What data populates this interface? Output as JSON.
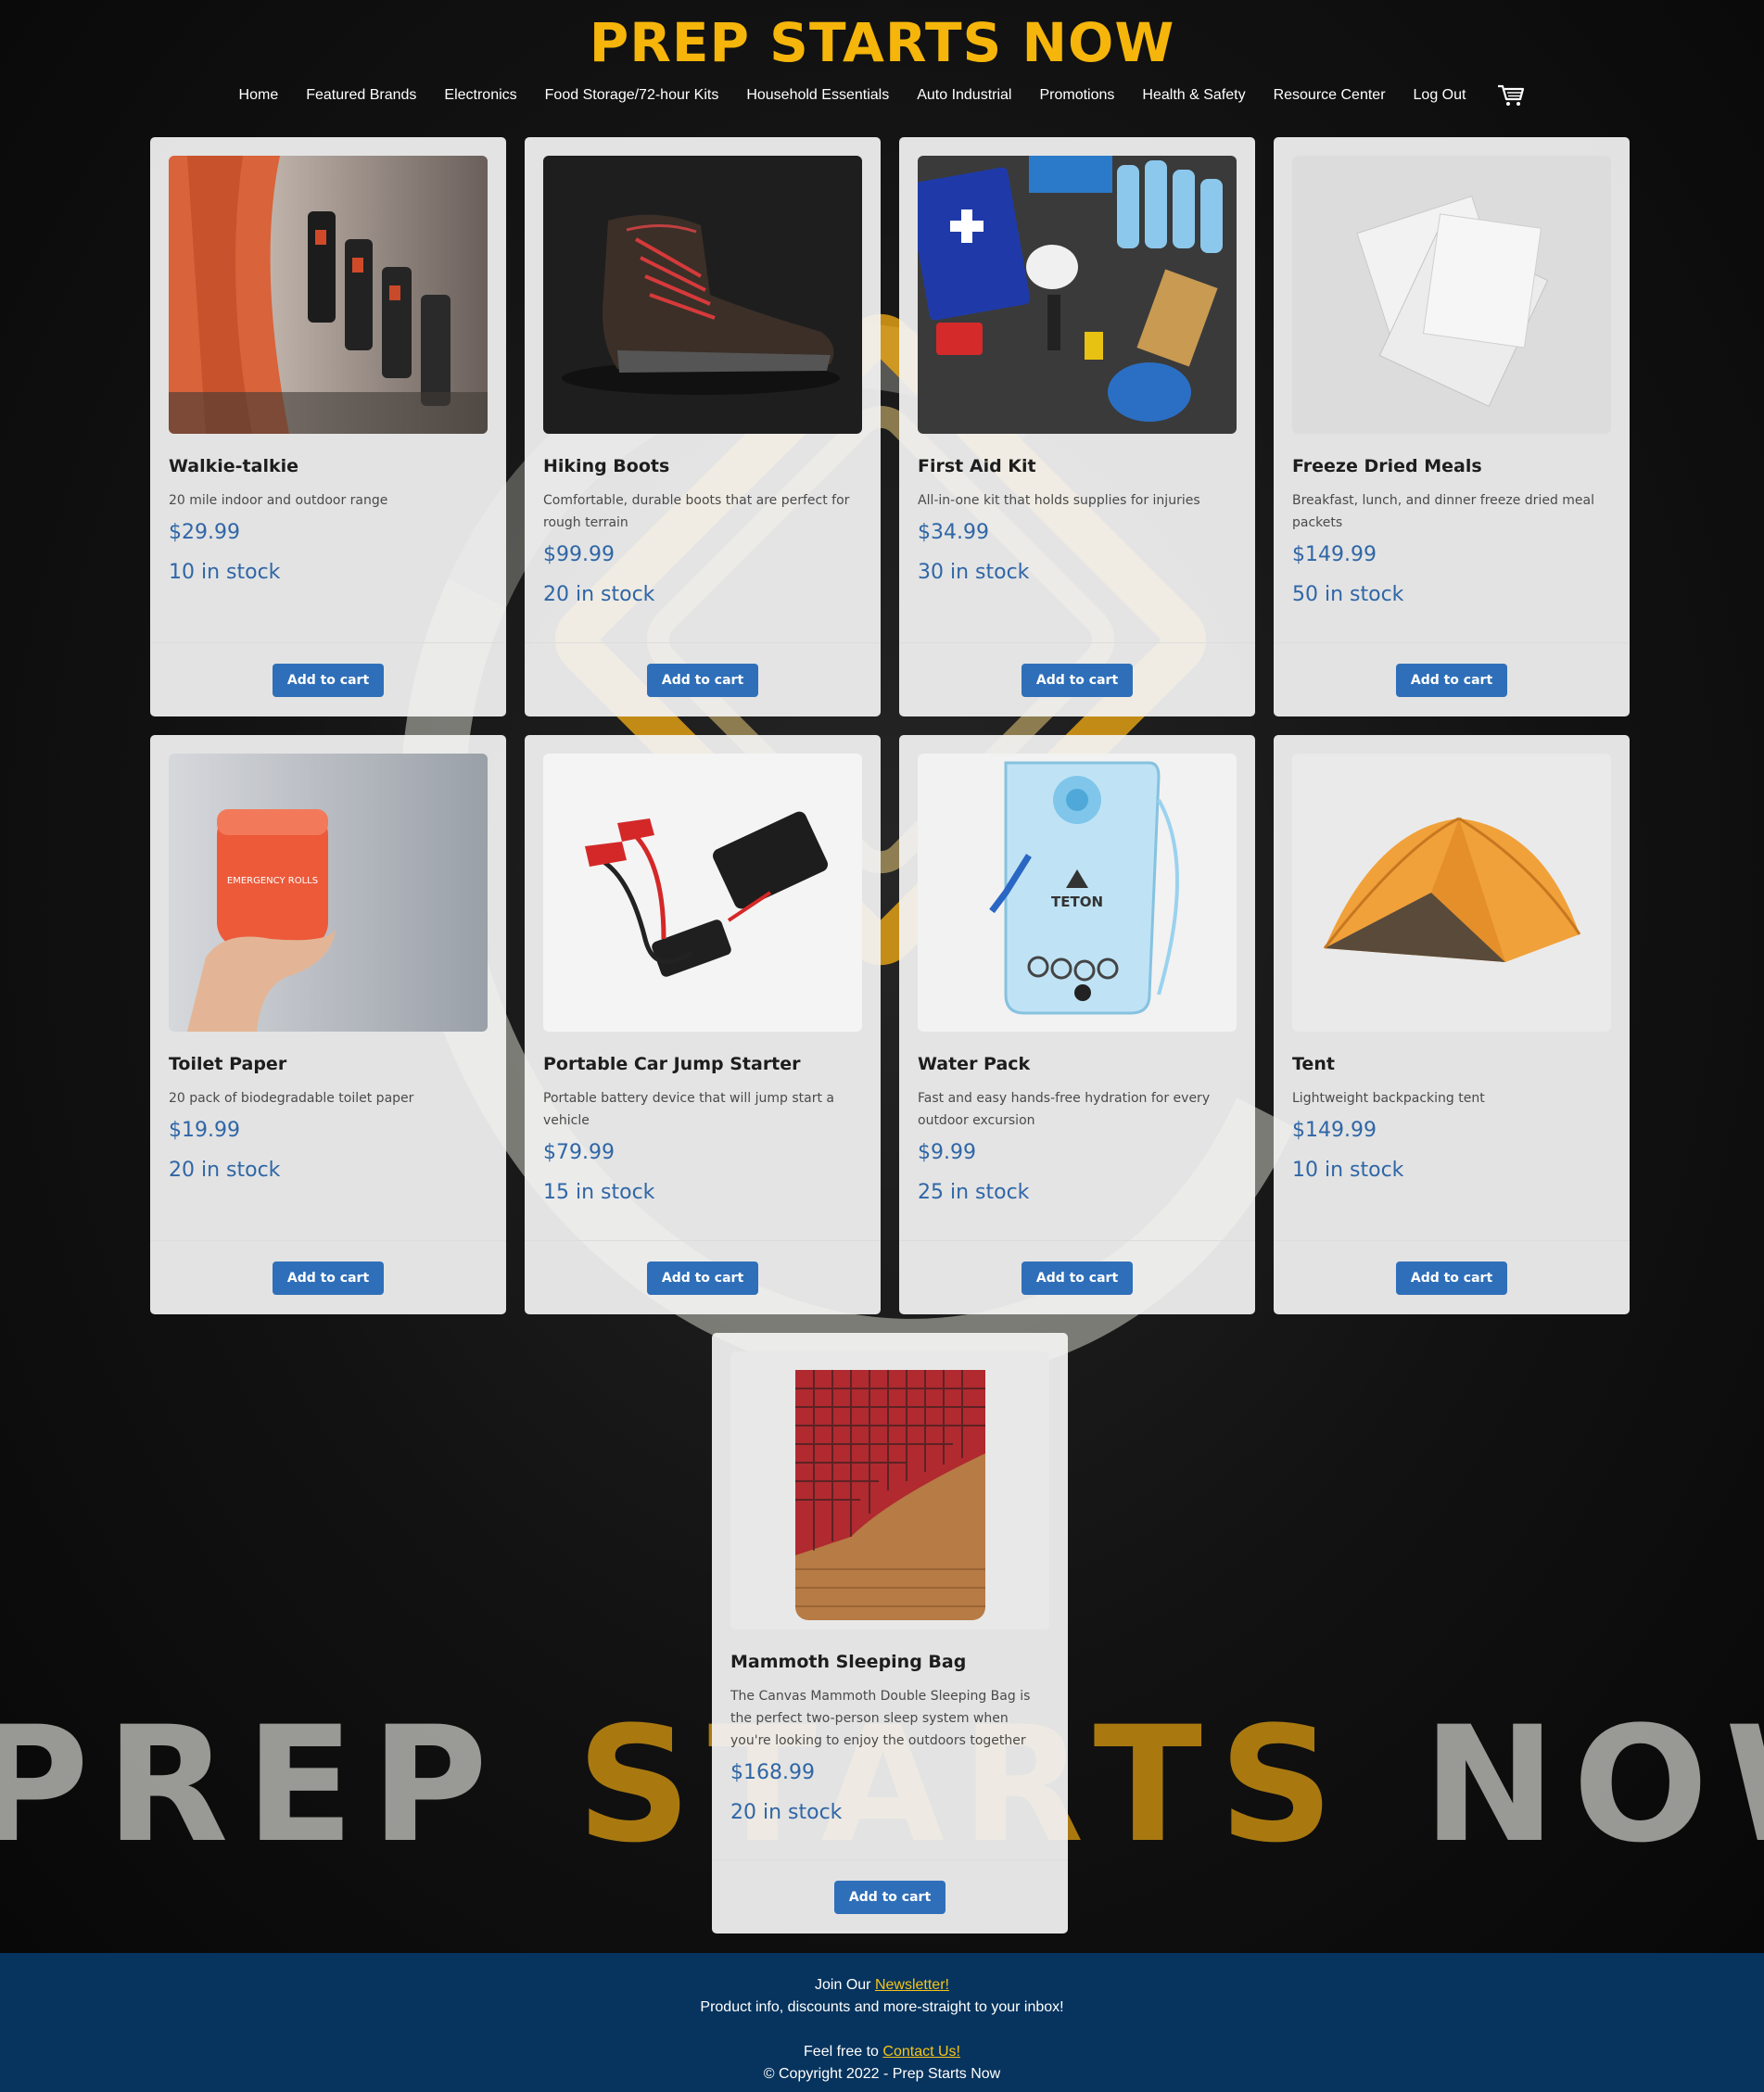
{
  "site": {
    "title": "PREP STARTS NOW"
  },
  "nav": {
    "items": [
      {
        "label": "Home"
      },
      {
        "label": "Featured Brands"
      },
      {
        "label": "Electronics"
      },
      {
        "label": "Food Storage/72-hour Kits"
      },
      {
        "label": "Household Essentials"
      },
      {
        "label": "Auto Industrial"
      },
      {
        "label": "Promotions"
      },
      {
        "label": "Health & Safety"
      },
      {
        "label": "Resource Center"
      },
      {
        "label": "Log Out"
      }
    ],
    "cart_icon": "shopping-cart-icon"
  },
  "background": {
    "word1": "PREP",
    "word2": "STARTS",
    "word3": "NOW",
    "colors": {
      "gold": "#f5b50a",
      "silver": "#c8c8c3"
    }
  },
  "products": [
    {
      "title": "Walkie-talkie",
      "desc": "20 mile indoor and outdoor range",
      "price": "$29.99",
      "stock": "10 in stock",
      "button": "Add to cart",
      "image": "walkie-talkie-photo"
    },
    {
      "title": "Hiking Boots",
      "desc": "Comfortable, durable boots that are perfect for rough terrain",
      "price": "$99.99",
      "stock": "20 in stock",
      "button": "Add to cart",
      "image": "hiking-boot-photo"
    },
    {
      "title": "First Aid Kit",
      "desc": "All-in-one kit that holds supplies for injuries",
      "price": "$34.99",
      "stock": "30 in stock",
      "button": "Add to cart",
      "image": "first-aid-kit-photo"
    },
    {
      "title": "Freeze Dried Meals",
      "desc": "Breakfast, lunch, and dinner freeze dried meal packets",
      "price": "$149.99",
      "stock": "50 in stock",
      "button": "Add to cart",
      "image": "meal-packets-photo"
    },
    {
      "title": "Toilet Paper",
      "desc": "20 pack of biodegradable toilet paper",
      "price": "$19.99",
      "stock": "20 in stock",
      "button": "Add to cart",
      "image": "toilet-paper-photo"
    },
    {
      "title": "Portable Car Jump Starter",
      "desc": "Portable battery device that will jump start a vehicle",
      "price": "$79.99",
      "stock": "15 in stock",
      "button": "Add to cart",
      "image": "jump-starter-photo"
    },
    {
      "title": "Water Pack",
      "desc": "Fast and easy hands-free hydration for every outdoor excursion",
      "price": "$9.99",
      "stock": "25 in stock",
      "button": "Add to cart",
      "image": "water-pack-photo"
    },
    {
      "title": "Tent",
      "desc": "Lightweight backpacking tent",
      "price": "$149.99",
      "stock": "10 in stock",
      "button": "Add to cart",
      "image": "tent-photo"
    },
    {
      "title": "Mammoth Sleeping Bag",
      "desc": "The Canvas Mammoth Double Sleeping Bag is the perfect two-person sleep system when you're looking to enjoy the outdoors together",
      "price": "$168.99",
      "stock": "20 in stock",
      "button": "Add to cart",
      "image": "sleeping-bag-photo"
    }
  ],
  "product_images": {
    "water_pack_brand": "TETON",
    "toilet_paper_label": "EMERGENCY ROLLS"
  },
  "footer": {
    "newsletter_prefix": "Join Our ",
    "newsletter_link": "Newsletter!",
    "newsletter_sub": "Product info, discounts and more-straight to your inbox!",
    "contact_prefix": "Feel free to ",
    "contact_link": "Contact Us!",
    "copyright": "© Copyright 2022 - Prep Starts Now"
  }
}
